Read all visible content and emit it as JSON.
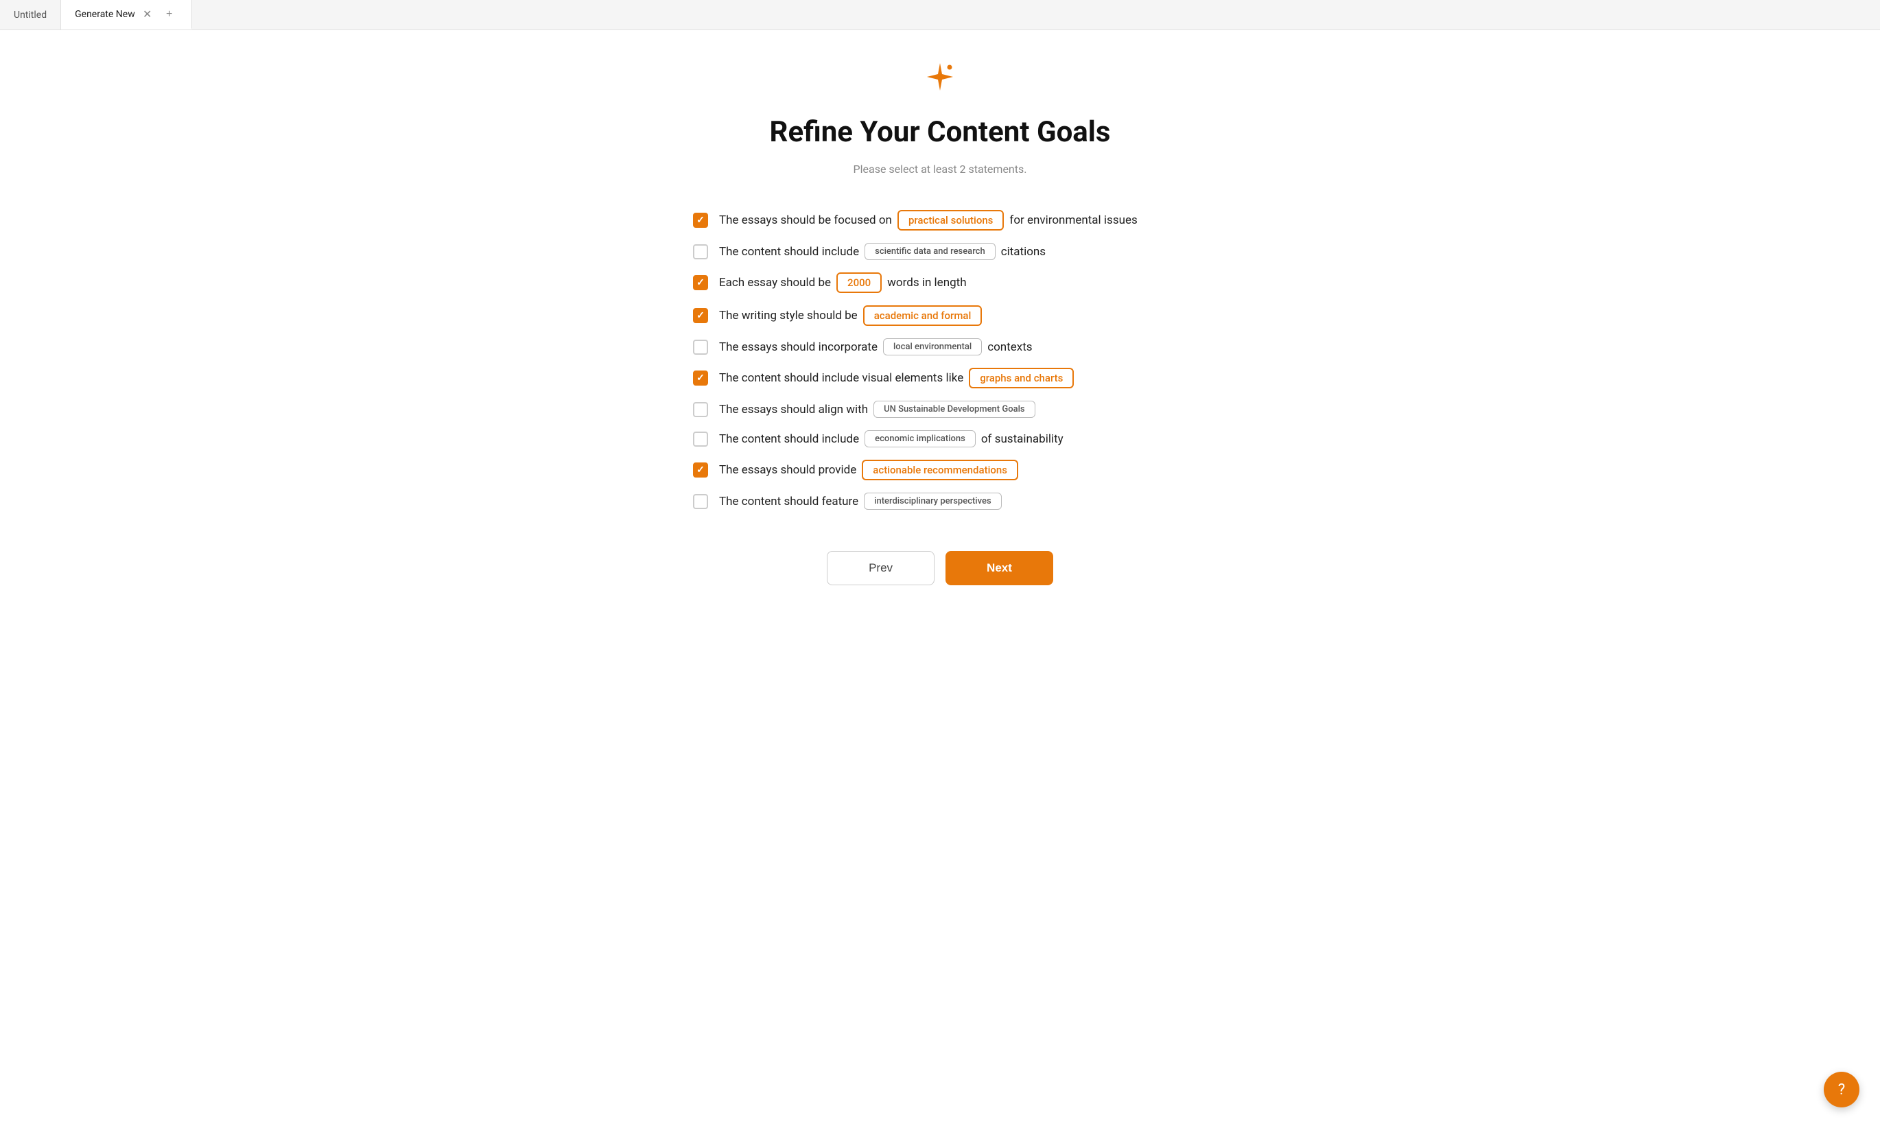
{
  "tabs": [
    {
      "id": "untitled",
      "label": "Untitled",
      "active": false
    },
    {
      "id": "generate-new",
      "label": "Generate New",
      "active": true
    }
  ],
  "header": {
    "icon": "sparkle",
    "title": "Refine Your Content Goals",
    "subtitle": "Please select at least 2 statements."
  },
  "statements": [
    {
      "id": 1,
      "checked": true,
      "prefix": "The essays should be focused on",
      "tag": "practical solutions",
      "tag_style": "orange",
      "suffix": "for environmental issues"
    },
    {
      "id": 2,
      "checked": false,
      "prefix": "The content should include",
      "tag": "scientific data and research",
      "tag_style": "gray",
      "suffix": "citations"
    },
    {
      "id": 3,
      "checked": true,
      "prefix": "Each essay should be",
      "tag": "2000",
      "tag_style": "orange",
      "suffix": "words in length"
    },
    {
      "id": 4,
      "checked": true,
      "prefix": "The writing style should be",
      "tag": "academic and formal",
      "tag_style": "orange",
      "suffix": ""
    },
    {
      "id": 5,
      "checked": false,
      "prefix": "The essays should incorporate",
      "tag": "local environmental",
      "tag_style": "gray",
      "suffix": "contexts"
    },
    {
      "id": 6,
      "checked": true,
      "prefix": "The content should include visual elements like",
      "tag": "graphs and charts",
      "tag_style": "orange",
      "suffix": ""
    },
    {
      "id": 7,
      "checked": false,
      "prefix": "The essays should align with",
      "tag": "UN Sustainable Development Goals",
      "tag_style": "gray",
      "suffix": ""
    },
    {
      "id": 8,
      "checked": false,
      "prefix": "The content should include",
      "tag": "economic implications",
      "tag_style": "gray",
      "suffix": "of sustainability"
    },
    {
      "id": 9,
      "checked": true,
      "prefix": "The essays should provide",
      "tag": "actionable recommendations",
      "tag_style": "orange",
      "suffix": ""
    },
    {
      "id": 10,
      "checked": false,
      "prefix": "The content should feature",
      "tag": "interdisciplinary perspectives",
      "tag_style": "gray",
      "suffix": ""
    }
  ],
  "buttons": {
    "prev": "Prev",
    "next": "Next"
  },
  "support_icon": "?",
  "accent_color": "#e8780a"
}
